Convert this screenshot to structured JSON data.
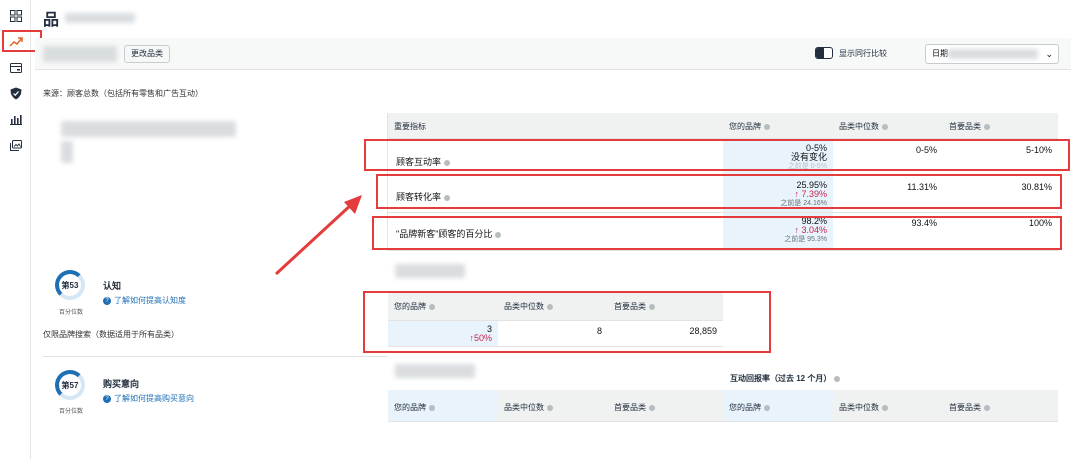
{
  "page": {
    "title": "品"
  },
  "sidebar": {
    "items": [
      {
        "icon": "dashboard-grid-icon"
      },
      {
        "icon": "trend-up-icon",
        "active": true
      },
      {
        "icon": "card-icon"
      },
      {
        "icon": "shield-icon"
      },
      {
        "icon": "bar-chart-icon"
      },
      {
        "icon": "image-gallery-icon"
      }
    ]
  },
  "filter_bar": {
    "change_category_label": "更改品类",
    "compare_toggle_label": "显示同行比较",
    "date_select_value": "日期"
  },
  "source": {
    "text": "来源：顾客总数（包括所有零售和广告互动）"
  },
  "metrics": {
    "headers": {
      "metric": "重要指标",
      "your_brand": "您的品牌",
      "category_median": "品类中位数",
      "top_category": "首要品类"
    },
    "rows": [
      {
        "name": "顾客互动率",
        "yours_main": "0-5%",
        "yours_change": "没有变化",
        "yours_prev": "之前是 0-5%",
        "median": "0-5%",
        "top": "5-10%"
      },
      {
        "name": "顾客转化率",
        "yours_main": "25.95%",
        "yours_change": "↑ 7.39%",
        "yours_prev": "之前是 24.16%",
        "median": "11.31%",
        "top": "30.81%"
      },
      {
        "name": "\"品牌新客\"顾客的百分比",
        "yours_main": "98.2%",
        "yours_change": "↑ 3.04%",
        "yours_prev": "之前是 95.3%",
        "median": "93.4%",
        "top": "100%"
      }
    ]
  },
  "awareness": {
    "percentile": "第53",
    "percentile_caption": "百分位数",
    "title": "认知",
    "link": "了解如何提高认知度",
    "note": "仅限品牌搜索（数据适用于所有品类）",
    "headers": {
      "your_brand": "您的品牌",
      "category_median": "品类中位数",
      "top_category": "首要品类"
    },
    "values": {
      "yours": "3",
      "yours_change": "↑50%",
      "median": "8",
      "top": "28,859"
    }
  },
  "purchase_intent": {
    "percentile": "第57",
    "percentile_caption": "百分位数",
    "title": "购买意向",
    "link": "了解如何提高购买意向",
    "repurchase_header": "互动回报率（过去 12 个月）",
    "headers": {
      "your_brand": "您的品牌",
      "category_median": "品类中位数",
      "top_category": "首要品类"
    }
  }
}
